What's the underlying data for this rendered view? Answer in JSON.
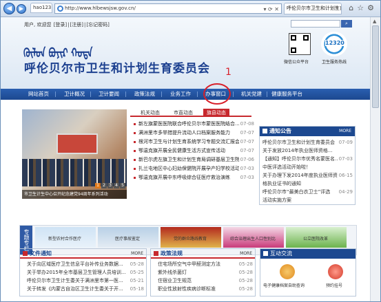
{
  "browser": {
    "tab_label": "hao123",
    "url": "http://www.hlbewsjsw.gov.cn/",
    "page_tab": "呼伦贝尔市卫生和计划生育..."
  },
  "header": {
    "user_label": "用户, 欢迎您",
    "login": "[登录]",
    "register": "[注册]",
    "forgot": "[忘记密码]",
    "mongolian": "ᠬᠥᠯᠥᠨ ᠪᠤᠶᠢᠷ ᠬᠣᠲᠠ",
    "title": "呼伦贝尔市卫生和计划生育委员会",
    "wechat_caption": "微信公众平台",
    "hotline_number": "12320",
    "hotline_caption": "卫生服务热线"
  },
  "nav": [
    "网站首页",
    "卫计概况",
    "卫计要闻",
    "政策法规",
    "业务工作",
    "办事窗口",
    "机关党建",
    "健康服务平台"
  ],
  "annotation": {
    "label": "1"
  },
  "slider": {
    "caption": "市卫生计生中心召开纪念建党94周年系列活动",
    "dots": [
      "1",
      "2",
      "3",
      "4",
      "5"
    ]
  },
  "news": {
    "tabs": [
      "机关动态",
      "市直动态",
      "旗县动态"
    ],
    "items": [
      {
        "title": "新左旗蒙医医院联合呼伦贝尔市蒙医医院结合...",
        "date": "07-08"
      },
      {
        "title": "满洲里市多举措提升流动人口档案服务能力",
        "date": "07-07"
      },
      {
        "title": "根河市卫生与计划生育系统学习专题交流汇报会",
        "date": "07-07"
      },
      {
        "title": "鄂温克旗开展全民健康生活方式宣传活动",
        "date": "07-07"
      },
      {
        "title": "新巴尔虎左旗卫生和计划生育局调研基层卫生院",
        "date": "07-06"
      },
      {
        "title": "扎兰屯地区中心妇幼保健院开展孕产妇学校活动",
        "date": "07-03"
      },
      {
        "title": "鄂温克旗开展中东呼吸综合征医疗救治演练",
        "date": "07-03"
      }
    ]
  },
  "notice": {
    "title": "通知公告",
    "more": "MORE",
    "items": [
      {
        "title": "呼伦贝尔市卫生和计划生育委员会",
        "date": "07-09"
      },
      {
        "title": "关于发放2014年执业医师资格...",
        "date": ""
      },
      {
        "title": "【通知】呼伦贝尔市优秀名蒙医名...",
        "date": "07-03"
      },
      {
        "title": "中医评选活动开始啦！",
        "date": ""
      },
      {
        "title": "关于办理下发2014年度执业医师资...",
        "date": "06-15"
      },
      {
        "title": "格执业证书的通知",
        "date": ""
      },
      {
        "title": "呼伦贝尔市“最美白衣卫士”评选",
        "date": "04-29"
      },
      {
        "title": "活动实施方案",
        "date": ""
      }
    ]
  },
  "topic": {
    "label": "专题专栏",
    "items": [
      "新型农村合作医疗",
      "医疗事故鉴定",
      "党的群众路线教育",
      "综合治理出生人口性别比",
      "公立医院改革"
    ]
  },
  "docs": {
    "title": "文件通知",
    "more": "MORE",
    "items": [
      {
        "title": "关于向区域医疗卫生信息平台补传业务数据...",
        "date": "05-28"
      },
      {
        "title": "关于举办2015年全市基层卫生管理人员培训...",
        "date": "05-25"
      },
      {
        "title": "呼伦贝尔市卫生计生委关于满洲里市第一医...",
        "date": "05-21"
      },
      {
        "title": "关于转发《内蒙古自治区卫生计生委关于开...",
        "date": "05-18"
      }
    ]
  },
  "policy": {
    "title": "政策法规",
    "more": "MORE",
    "items": [
      {
        "title": "住宅场所空气中甲醛测定方法",
        "date": "05-28"
      },
      {
        "title": "紫外线杀菌灯",
        "date": "05-28"
      },
      {
        "title": "住宿业卫生规范",
        "date": "05-28"
      },
      {
        "title": "职业性放射性疾病诊断标准",
        "date": "05-28"
      }
    ]
  },
  "interact": {
    "title": "互动交流",
    "items": [
      "电子健康档案自助查询",
      "预约挂号"
    ]
  }
}
